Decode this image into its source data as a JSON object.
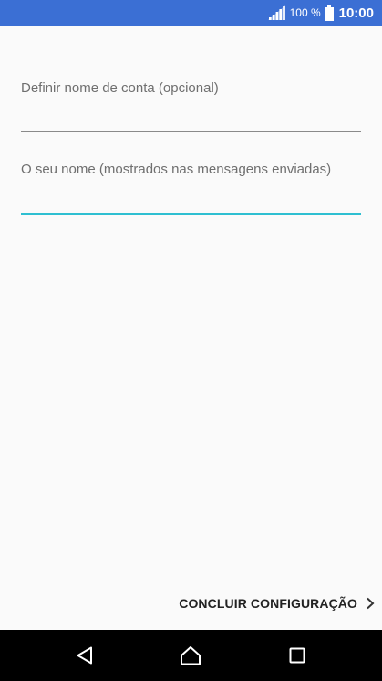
{
  "status_bar": {
    "battery_percent": "100 %",
    "time": "10:00",
    "icons": [
      "signal-icon",
      "battery-icon"
    ],
    "background_color": "#3b6fd4"
  },
  "form": {
    "account_name_label": "Definir nome de conta (opcional)",
    "your_name_label": "O seu nome (mostrados nas mensagens enviadas)",
    "accent_color": "#2ebfd1"
  },
  "footer": {
    "finish_label": "CONCLUIR CONFIGURAÇÃO",
    "finish_icon": "chevron-right-icon"
  },
  "nav_bar": {
    "icons": [
      "back-icon",
      "home-icon",
      "recents-icon"
    ]
  }
}
